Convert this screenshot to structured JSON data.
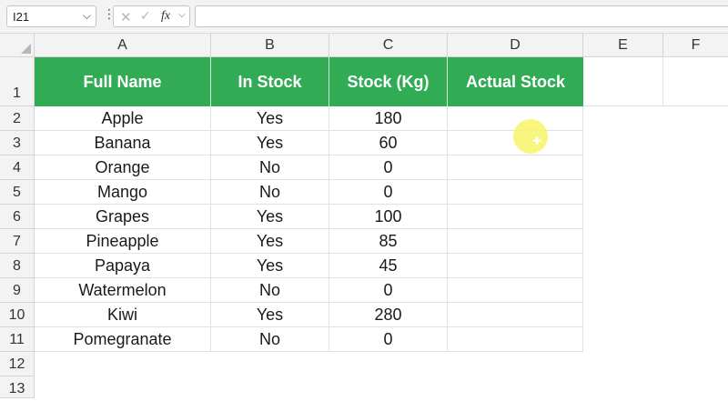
{
  "formula_bar": {
    "name_box": "I21",
    "name_box_chevron": "chevron-down-icon",
    "more_icon": "vertical-ellipsis-icon",
    "cancel_icon": "cancel-x-icon",
    "enter_icon": "checkmark-icon",
    "fx_label": "fx",
    "fx_chevron": "chevron-down-icon",
    "formula_value": ""
  },
  "columns": [
    "A",
    "B",
    "C",
    "D",
    "E",
    "F"
  ],
  "rows": [
    "1",
    "2",
    "3",
    "4",
    "5",
    "6",
    "7",
    "8",
    "9",
    "10",
    "11",
    "12",
    "13"
  ],
  "table": {
    "headers": [
      "Full Name",
      "In Stock",
      "Stock (Kg)",
      "Actual Stock"
    ],
    "rows": [
      [
        "Apple",
        "Yes",
        "180",
        ""
      ],
      [
        "Banana",
        "Yes",
        "60",
        ""
      ],
      [
        "Orange",
        "No",
        "0",
        ""
      ],
      [
        "Mango",
        "No",
        "0",
        ""
      ],
      [
        "Grapes",
        "Yes",
        "100",
        ""
      ],
      [
        "Pineapple",
        "Yes",
        "85",
        ""
      ],
      [
        "Papaya",
        "Yes",
        "45",
        ""
      ],
      [
        "Watermelon",
        "No",
        "0",
        ""
      ],
      [
        "Kiwi",
        "Yes",
        "280",
        ""
      ],
      [
        "Pomegranate",
        "No",
        "0",
        ""
      ]
    ]
  },
  "colors": {
    "header_fill": "#32ab55",
    "header_text": "#ffffff",
    "cursor_highlight": "#f8f46a"
  }
}
